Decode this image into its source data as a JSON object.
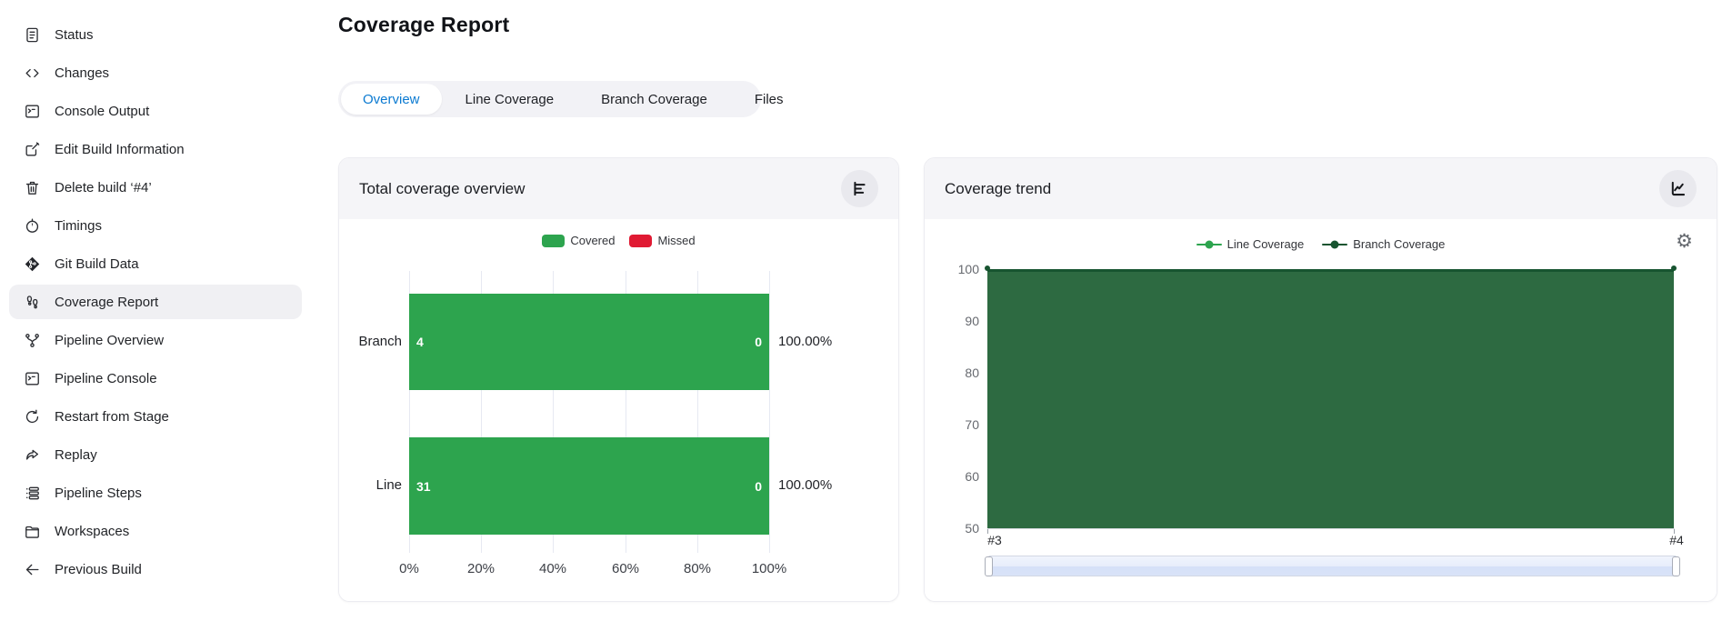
{
  "header": {
    "title": "Coverage Report"
  },
  "sidebar": {
    "items": [
      {
        "label": "Status",
        "icon": "document-icon"
      },
      {
        "label": "Changes",
        "icon": "code-icon"
      },
      {
        "label": "Console Output",
        "icon": "terminal-icon"
      },
      {
        "label": "Edit Build Information",
        "icon": "edit-icon"
      },
      {
        "label": "Delete build ‘#4’",
        "icon": "trash-icon"
      },
      {
        "label": "Timings",
        "icon": "stopwatch-icon"
      },
      {
        "label": "Git Build Data",
        "icon": "git-icon"
      },
      {
        "label": "Coverage Report",
        "icon": "footsteps-icon",
        "selected": true
      },
      {
        "label": "Pipeline Overview",
        "icon": "branch-icon"
      },
      {
        "label": "Pipeline Console",
        "icon": "terminal-icon"
      },
      {
        "label": "Restart from Stage",
        "icon": "restart-icon"
      },
      {
        "label": "Replay",
        "icon": "replay-icon"
      },
      {
        "label": "Pipeline Steps",
        "icon": "steps-icon"
      },
      {
        "label": "Workspaces",
        "icon": "folder-icon"
      },
      {
        "label": "Previous Build",
        "icon": "arrow-left-icon"
      }
    ]
  },
  "tabs": [
    {
      "label": "Overview",
      "active": true
    },
    {
      "label": "Line Coverage"
    },
    {
      "label": "Branch Coverage"
    },
    {
      "label": "Files"
    }
  ],
  "cards": {
    "overview": {
      "title": "Total coverage overview"
    },
    "trend": {
      "title": "Coverage trend"
    }
  },
  "icons": {
    "gear_glyph": "⚙"
  },
  "colors": {
    "accent_blue": "#0b7ad1",
    "covered_green": "#2DA44E",
    "missed_red": "#E01A33",
    "branch_dark_green": "#175430",
    "trend_fill": "#2D6A41"
  },
  "chart_data": [
    {
      "type": "bar",
      "orientation": "horizontal",
      "title": "Total coverage overview",
      "categories": [
        "Branch",
        "Line"
      ],
      "series": [
        {
          "name": "Covered",
          "color": "#2DA44E",
          "values": [
            4,
            31
          ]
        },
        {
          "name": "Missed",
          "color": "#E01A33",
          "values": [
            0,
            0
          ]
        }
      ],
      "percent_labels": [
        "100.00%",
        "100.00%"
      ],
      "xlabel_ticks": [
        "0%",
        "20%",
        "40%",
        "60%",
        "80%",
        "100%"
      ],
      "xlim": [
        0,
        100
      ],
      "grid": true,
      "legend_position": "top"
    },
    {
      "type": "area",
      "title": "Coverage trend",
      "x": [
        "#3",
        "#4"
      ],
      "series": [
        {
          "name": "Line Coverage",
          "color": "#2DA44E",
          "values": [
            100,
            100
          ]
        },
        {
          "name": "Branch Coverage",
          "color": "#175430",
          "values": [
            100,
            100
          ]
        }
      ],
      "ylim": [
        50,
        100
      ],
      "yticks": [
        100,
        90,
        80,
        70,
        60,
        50
      ],
      "grid": false,
      "legend_position": "top",
      "datazoom": {
        "start": "#3",
        "end": "#4"
      }
    }
  ]
}
